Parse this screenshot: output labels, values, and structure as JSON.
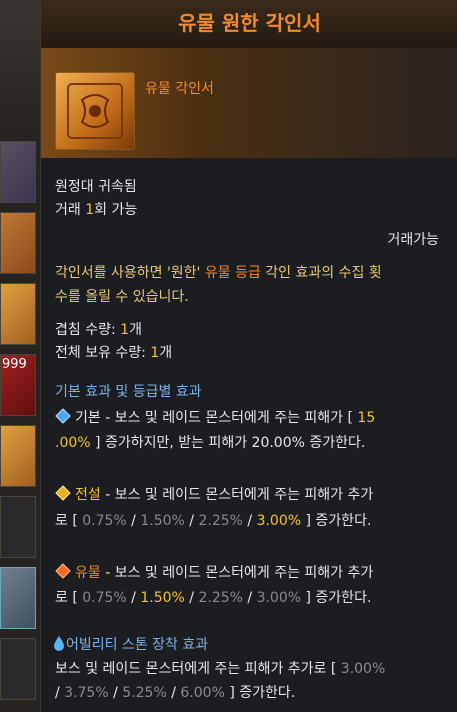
{
  "title": "유물 원한 각인서",
  "item_grade": "유물 각인서",
  "bind": "원정대 귀속됨",
  "trade_prefix": "거래 ",
  "trade_count": "1",
  "trade_suffix": "회 가능",
  "tradable": "거래가능",
  "desc": {
    "l1_a": "각인서를 사용하면 '원한' ",
    "l1_b": "유물 등급",
    "l1_c": " 각인 효과의 수집 횟",
    "l2": "수를 올릴 수 있습니다."
  },
  "stack_label": "겹침 수량: ",
  "stack_value": "1",
  "stack_unit": "개",
  "owned_label": "전체 보유 수량: ",
  "owned_value": "1",
  "owned_unit": "개",
  "effects_header": "기본 효과 및 등급별 효과",
  "basic": {
    "label": "기본 - 보스 및 레이드 몬스터에게 주는 피해가 [ ",
    "v1": "15",
    "v2": ".00%",
    "rest": " ] 증가하지만, 받는 피해가 20.00% 증가한다."
  },
  "legend": {
    "grade": "전설",
    "text": " - 보스 및 레이드 몬스터에게 주는 피해가 추가",
    "l2_a": "로 [ ",
    "vals": [
      "0.75%",
      "1.50%",
      "2.25%",
      "3.00%"
    ],
    "l2_b": " ] 증가한다."
  },
  "relic": {
    "grade": "유물",
    "text": " - 보스 및 레이드 몬스터에게 주는 피해가 추가",
    "l2_a": "로 [ ",
    "vals": [
      "0.75%",
      "1.50%",
      "2.25%",
      "3.00%"
    ],
    "l2_b": " ] 증가한다."
  },
  "ability": {
    "header": "어빌리티 스톤 장착 효과",
    "l1": "보스 및 레이드 몬스터에게 주는 피해가 추가로 [ ",
    "v1": "3.00%",
    "sep": " / ",
    "v2": "3.75%",
    "v3": "5.25%",
    "v4": "6.00%",
    "l2_end": " ] 증가한다."
  },
  "inventory": {
    "stack_count": "999"
  },
  "colors": {
    "grade_orange": "#f08a2a",
    "highlight_yellow": "#f5c32c",
    "header_blue": "#7fb2e6"
  }
}
